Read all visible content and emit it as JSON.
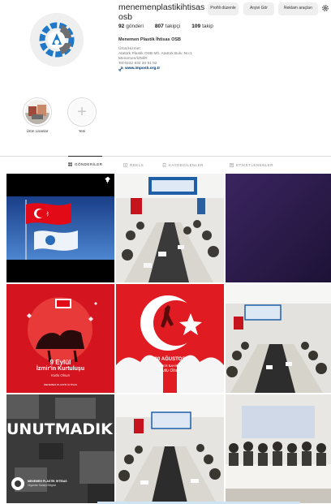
{
  "profile": {
    "username": "menemenplastikihtisasosb",
    "buttons": {
      "edit": "Profili düzenle",
      "archive": "Arşivi Gör",
      "ads": "Reklam araçları"
    },
    "stats": [
      {
        "value": "92",
        "label": "gönderi"
      },
      {
        "value": "807",
        "label": "takipçi"
      },
      {
        "value": "109",
        "label": "takip"
      }
    ],
    "full_name": "Menemen Plastik İhtisas OSB",
    "category": "Ürün/Hizmet",
    "address_line1": "Atatürk Plastik OSB Mh. Atatürk Bulv. No:1",
    "address_line2": "Menemen/İZMİR",
    "phone": "Tel:0232 832 30 91 92",
    "website": "www.imposb.org.tr"
  },
  "highlights": [
    {
      "label": "Ürün Lisanlar"
    },
    {
      "label": "Yeni"
    }
  ],
  "tabs": [
    {
      "label": "GÖNDERİLER",
      "active": true
    },
    {
      "label": "REELS",
      "active": false
    },
    {
      "label": "KAYDEDİLENLER",
      "active": false
    },
    {
      "label": "ETİKETLENENLER",
      "active": false
    }
  ],
  "posts": {
    "ataturk_caption_line1": "9 Eylül",
    "ataturk_caption_line2": "İzmir'in Kurtuluşu",
    "ataturk_caption_line3": "Kutlu Olsun",
    "victory_caption_line1": "30 AĞUSTOS",
    "victory_caption_line2": "ZAFER BAYRAMI",
    "victory_caption_line3": "Kutlu Olsun",
    "earthquake_title": "UNUTMADIK!",
    "brand_line1": "MENEMEN PLASTİK İHTİSAS",
    "brand_line2": "Organize Sanayi Bölgesi"
  },
  "colors": {
    "turkish_red": "#e30a17",
    "accent_blue": "#0095f6",
    "logo_blue": "#1f78c8",
    "logo_grey": "#6d6e71"
  }
}
